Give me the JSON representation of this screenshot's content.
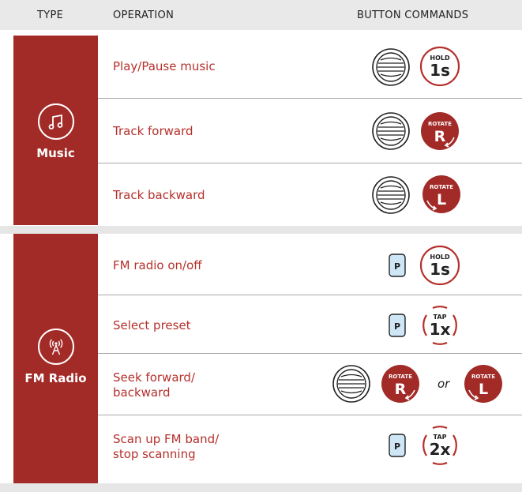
{
  "header": {
    "type": "TYPE",
    "operation": "OPERATION",
    "commands": "BUTTON COMMANDS"
  },
  "sections": [
    {
      "type_label": "Music",
      "icon": "music-note-icon",
      "rows": [
        {
          "operation": "Play/Pause music",
          "badge": {
            "top": "HOLD",
            "main": "1s"
          }
        },
        {
          "operation": "Track forward",
          "badge": {
            "top": "ROTATE",
            "main": "R"
          }
        },
        {
          "operation": "Track backward",
          "badge": {
            "top": "ROTATE",
            "main": "L"
          }
        }
      ]
    },
    {
      "type_label": "FM Radio",
      "icon": "radio-antenna-icon",
      "rows": [
        {
          "operation": "FM radio on/off",
          "button": "P",
          "badge": {
            "top": "HOLD",
            "main": "1s"
          }
        },
        {
          "operation": "Select preset",
          "button": "P",
          "badge": {
            "top": "TAP",
            "main": "1x"
          }
        },
        {
          "operation_lines": [
            "Seek forward/",
            "backward"
          ],
          "badge_r": {
            "top": "ROTATE",
            "main": "R"
          },
          "or_text": "or",
          "badge_l": {
            "top": "ROTATE",
            "main": "L"
          }
        },
        {
          "operation_lines": [
            "Scan up FM band/",
            "stop scanning"
          ],
          "button": "P",
          "badge": {
            "top": "TAP",
            "main": "2x"
          }
        }
      ]
    }
  ],
  "colors": {
    "accent": "#a22b28",
    "p_button": "#cfe6f7",
    "header_bg": "#e9e9e9"
  }
}
